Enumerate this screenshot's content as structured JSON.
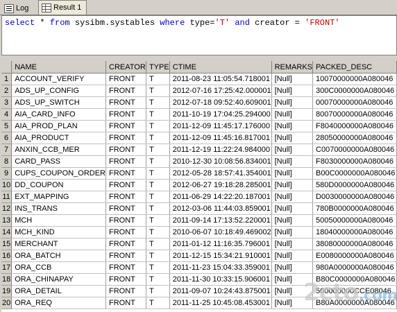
{
  "tabs": [
    {
      "label": "Log",
      "icon": "log-icon",
      "active": false
    },
    {
      "label": "Result 1",
      "icon": "result-grid-icon",
      "active": true
    }
  ],
  "sql": {
    "parts": [
      {
        "text": "select",
        "kind": "kw"
      },
      {
        "text": " * ",
        "kind": "plain"
      },
      {
        "text": "from",
        "kind": "kw"
      },
      {
        "text": " sysibm.systables ",
        "kind": "plain"
      },
      {
        "text": "where",
        "kind": "kw"
      },
      {
        "text": " type=",
        "kind": "plain"
      },
      {
        "text": "'T'",
        "kind": "str"
      },
      {
        "text": " ",
        "kind": "plain"
      },
      {
        "text": "and",
        "kind": "kw"
      },
      {
        "text": " creator = ",
        "kind": "plain"
      },
      {
        "text": "'FRONT'",
        "kind": "str"
      }
    ]
  },
  "grid": {
    "columns": [
      "NAME",
      "CREATOR",
      "TYPE",
      "CTIME",
      "REMARKS",
      "PACKED_DESC"
    ],
    "rows": [
      [
        "1",
        "ACCOUNT_VERIFY",
        "FRONT",
        "T",
        "2011-08-23 11:05:54.718001",
        "[Null]",
        "10070000000A080046"
      ],
      [
        "2",
        "ADS_UP_CONFIG",
        "FRONT",
        "T",
        "2012-07-16 17:25:42.000001",
        "[Null]",
        "300C0000000A080046"
      ],
      [
        "3",
        "ADS_UP_SWITCH",
        "FRONT",
        "T",
        "2012-07-18 09:52:40.609001",
        "[Null]",
        "00070000000A080046"
      ],
      [
        "4",
        "AIA_CARD_INFO",
        "FRONT",
        "T",
        "2011-10-19 17:04:25.294000",
        "[Null]",
        "80070000000A080046"
      ],
      [
        "5",
        "AIA_PROD_PLAN",
        "FRONT",
        "T",
        "2011-12-09 11:45:17.176000",
        "[Null]",
        "F8040000000A080046"
      ],
      [
        "6",
        "AIA_PRODUCT",
        "FRONT",
        "T",
        "2011-12-09 11:45:16.817001",
        "[Null]",
        "28050000000A080046"
      ],
      [
        "7",
        "ANXIN_CCB_MER",
        "FRONT",
        "T",
        "2011-12-19 11:22:24.984000",
        "[Null]",
        "C0070000000A080046"
      ],
      [
        "8",
        "CARD_PASS",
        "FRONT",
        "T",
        "2010-12-30 10:08:56.834001",
        "[Null]",
        "F8030000000A080046"
      ],
      [
        "9",
        "CUPS_COUPON_ORDER",
        "FRONT",
        "T",
        "2012-05-28 18:57:41.354001",
        "[Null]",
        "B00C0000000A080046"
      ],
      [
        "10",
        "DD_COUPON",
        "FRONT",
        "T",
        "2012-06-27 19:18:28.285001",
        "[Null]",
        "580D0000000A080046"
      ],
      [
        "11",
        "EXT_MAPPING",
        "FRONT",
        "T",
        "2011-06-29 14:22:20.187001",
        "[Null]",
        "D0030000000A080046"
      ],
      [
        "12",
        "INS_TRANS",
        "FRONT",
        "T",
        "2012-03-06 11:44:03.859001",
        "[Null]",
        "780B0000000A080046"
      ],
      [
        "13",
        "MCH",
        "FRONT",
        "T",
        "2011-09-14 17:13:52.220001",
        "[Null]",
        "50050000000A080046"
      ],
      [
        "14",
        "MCH_KIND",
        "FRONT",
        "T",
        "2010-06-07 10:18:49.469002",
        "[Null]",
        "18040000000A080046"
      ],
      [
        "15",
        "MERCHANT",
        "FRONT",
        "T",
        "2011-01-12 11:16:35.796001",
        "[Null]",
        "38080000000A080046"
      ],
      [
        "16",
        "ORA_BATCH",
        "FRONT",
        "T",
        "2011-12-15 15:34:21.910001",
        "[Null]",
        "E0080000000A080046"
      ],
      [
        "17",
        "ORA_CCB",
        "FRONT",
        "T",
        "2011-11-23 15:04:33.359001",
        "[Null]",
        "980A0000000A080046"
      ],
      [
        "18",
        "ORA_CHINAPAY",
        "FRONT",
        "T",
        "2011-11-30 10:33:15.906001",
        "[Null]",
        "B80C0000000A080046"
      ],
      [
        "19",
        "ORA_DETAIL",
        "FRONT",
        "T",
        "2011-09-07 10:24:43.875001",
        "[Null]",
        "500000000CCE08046"
      ],
      [
        "20",
        "ORA_REQ",
        "FRONT",
        "T",
        "2011-11-25 10:45:08.453001",
        "[Null]",
        "B80A0000000A080046"
      ]
    ]
  },
  "watermark": {
    "text": "2cto",
    "sub": ".com"
  }
}
